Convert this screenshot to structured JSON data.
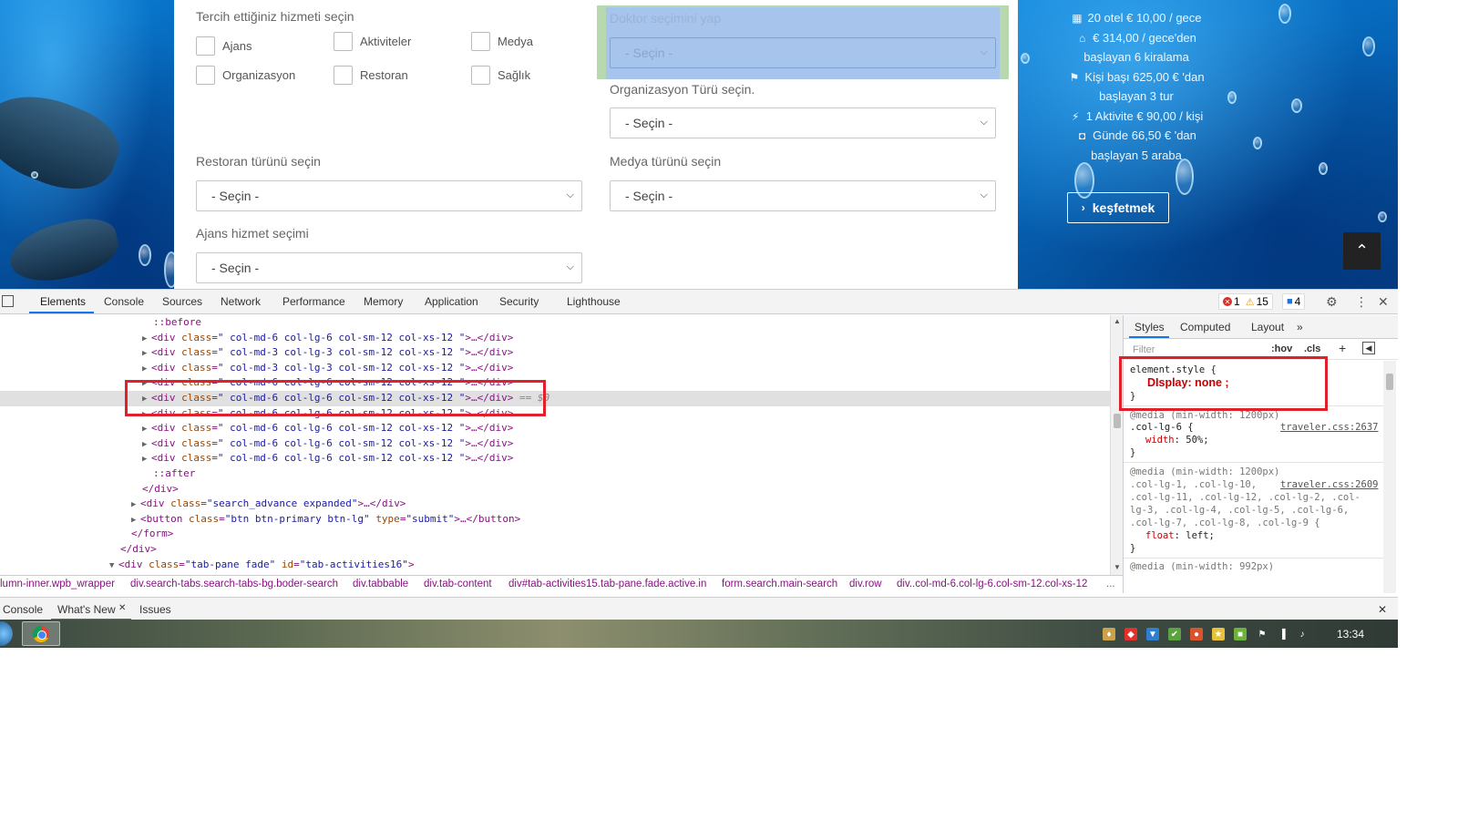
{
  "form": {
    "services_label": "Tercih ettiğiniz hizmeti seçin",
    "checkboxes": [
      "Ajans",
      "Aktiviteler",
      "Medya",
      "Organizasyon",
      "Restoran",
      "Sağlık"
    ],
    "doctor_label": "Doktor seçimini yap",
    "doctor_select": "- Seçin -",
    "org_label": "Organizasyon Türü seçin.",
    "org_select": "- Seçin -",
    "restaurant_label": "Restoran türünü seçin",
    "restaurant_select": "- Seçin -",
    "media_label": "Medya türünü seçin",
    "media_select": "- Seçin -",
    "agency_label": "Ajans hizmet seçimi",
    "agency_select": "- Seçin -"
  },
  "promo": {
    "lines": [
      "20 otel € 10,00 / gece",
      "€ 314,00 / gece'den",
      "başlayan 6 kiralama",
      "Kişi başı 625,00 € 'dan",
      "başlayan 3 tur",
      "1 Aktivite € 90,00 / kişi",
      "Günde 66,50 € 'dan",
      "başlayan 5 araba"
    ],
    "explore_label": "keşfetmek",
    "icons": [
      "building-icon",
      "home-icon",
      "flag-icon",
      "bolt-icon",
      "car-icon"
    ]
  },
  "devtools": {
    "tabs": [
      "Elements",
      "Console",
      "Sources",
      "Network",
      "Performance",
      "Memory",
      "Application",
      "Security",
      "Lighthouse"
    ],
    "errors": "1",
    "warnings": "15",
    "messages": "4",
    "dom": {
      "before": "::before",
      "after": "::after",
      "div_tag": "<div",
      "class_attr": "class",
      "close_div": ">…</div>",
      "c_md6": "\" col-md-6 col-lg-6 col-sm-12 col-xs-12 \"",
      "c_md3": "\" col-md-3 col-lg-3 col-sm-12 col-xs-12 \"",
      "selected_suffix": "== $0",
      "end_div": "</div>",
      "search_adv_open": "<div",
      "search_adv_class": "\"search_advance expanded\"",
      "button_open": "<button",
      "button_class": "\"btn btn-primary btn-lg\"",
      "type_attr": "type",
      "type_val": "\"submit\"",
      "close_button": ">…</button>",
      "end_form": "</form>",
      "tab_pane_open": "<div",
      "tab_pane_class": "\"tab-pane fade\"",
      "id_attr": "id",
      "tab_pane_id": "\"tab-activities16\"",
      "gt": ">"
    },
    "styles_tabs": [
      "Styles",
      "Computed",
      "Layout",
      "»"
    ],
    "filter_placeholder": "Filter",
    "hov": ":hov",
    "cls": ".cls",
    "element_style": "element.style {",
    "display_rule": "DIsplay: none ;",
    "close_brace": "}",
    "rule1_media": "@media (min-width: 1200px)",
    "rule1_selector": ".col-lg-6 {",
    "rule1_link": "traveler.css:2637",
    "rule1_decl": "width: 50%;",
    "rule2_media": "@media (min-width: 1200px)",
    "rule2_link": "traveler.css:2609",
    "rule2_selector_1": ".col-lg-1, .col-lg-10,",
    "rule2_selector_2": ".col-lg-11, .col-lg-12, .col-lg-2, .col-",
    "rule2_selector_3": "lg-3, .col-lg-4, .col-lg-5, .col-lg-6,",
    "rule2_selector_4": ".col-lg-7, .col-lg-8, .col-lg-9 {",
    "rule2_decl": "float: left;",
    "rule3_media": "@media (min-width: 992px)",
    "breadcrumb": [
      "lumn-inner.wpb_wrapper",
      "div.search-tabs.search-tabs-bg.boder-search",
      "div.tabbable",
      "div.tab-content",
      "div#tab-activities15.tab-pane.fade.active.in",
      "form.search.main-search",
      "div.row",
      "div..col-md-6.col-lg-6.col-sm-12.col-xs-12",
      "..."
    ],
    "drawer_tabs": [
      "Console",
      "What's New",
      "Issues"
    ]
  },
  "taskbar": {
    "clock": "13:34"
  },
  "colors": {
    "highlight": "#e0202b",
    "accent": "#1a73e8"
  }
}
